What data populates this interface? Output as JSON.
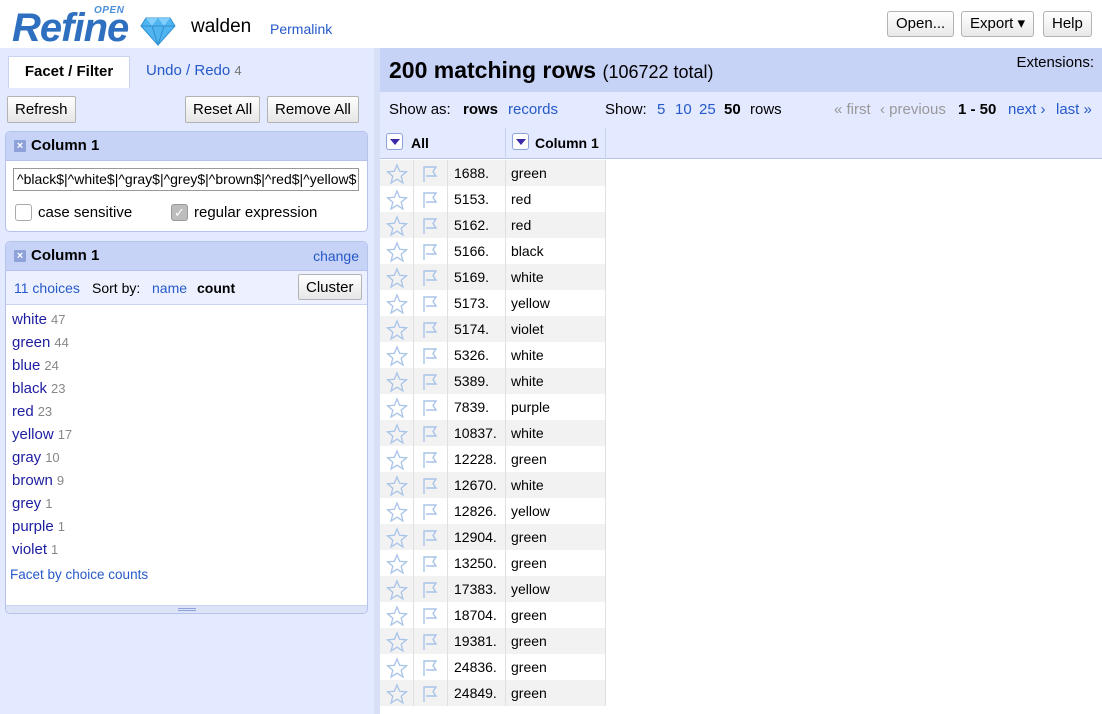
{
  "header": {
    "logo_open": "OPEN",
    "logo_refine": "Refine",
    "project_name": "walden",
    "permalink": "Permalink",
    "open_button": "Open...",
    "export_button": "Export ▾",
    "help_button": "Help"
  },
  "left": {
    "tab_facet": "Facet / Filter",
    "tab_undo": "Undo / Redo",
    "tab_undo_count": "4",
    "refresh": "Refresh",
    "reset_all": "Reset All",
    "remove_all": "Remove All",
    "text_facet": {
      "title": "Column 1",
      "value": "^black$|^white$|^gray$|^grey$|^brown$|^red$|^yellow$",
      "case_sensitive_label": "case sensitive",
      "case_sensitive": false,
      "regex_label": "regular expression",
      "regex": true
    },
    "list_facet": {
      "title": "Column 1",
      "change": "change",
      "choices_count": "11 choices",
      "sort_by": "Sort by:",
      "sort_name": "name",
      "sort_count": "count",
      "cluster": "Cluster",
      "choices": [
        {
          "label": "white",
          "count": "47"
        },
        {
          "label": "green",
          "count": "44"
        },
        {
          "label": "blue",
          "count": "24"
        },
        {
          "label": "black",
          "count": "23"
        },
        {
          "label": "red",
          "count": "23"
        },
        {
          "label": "yellow",
          "count": "17"
        },
        {
          "label": "gray",
          "count": "10"
        },
        {
          "label": "brown",
          "count": "9"
        },
        {
          "label": "grey",
          "count": "1"
        },
        {
          "label": "purple",
          "count": "1"
        },
        {
          "label": "violet",
          "count": "1"
        }
      ],
      "facet_by_counts": "Facet by choice counts"
    }
  },
  "right": {
    "matching": "200 matching rows",
    "total": "(106722 total)",
    "extensions": "Extensions:",
    "show_as": "Show as:",
    "rows": "rows",
    "records": "records",
    "show": "Show:",
    "page_sizes": [
      "5",
      "10",
      "25",
      "50"
    ],
    "rows_suffix": "rows",
    "first": "« first",
    "previous": "‹ previous",
    "range": "1 - 50",
    "next": "next ›",
    "last": "last »",
    "col_all": "All",
    "col_1": "Column 1",
    "rows_data": [
      {
        "n": "1688.",
        "v": "green"
      },
      {
        "n": "5153.",
        "v": "red"
      },
      {
        "n": "5162.",
        "v": "red"
      },
      {
        "n": "5166.",
        "v": "black"
      },
      {
        "n": "5169.",
        "v": "white"
      },
      {
        "n": "5173.",
        "v": "yellow"
      },
      {
        "n": "5174.",
        "v": "violet"
      },
      {
        "n": "5326.",
        "v": "white"
      },
      {
        "n": "5389.",
        "v": "white"
      },
      {
        "n": "7839.",
        "v": "purple"
      },
      {
        "n": "10837.",
        "v": "white"
      },
      {
        "n": "12228.",
        "v": "green"
      },
      {
        "n": "12670.",
        "v": "white"
      },
      {
        "n": "12826.",
        "v": "yellow"
      },
      {
        "n": "12904.",
        "v": "green"
      },
      {
        "n": "13250.",
        "v": "green"
      },
      {
        "n": "17383.",
        "v": "yellow"
      },
      {
        "n": "18704.",
        "v": "green"
      },
      {
        "n": "19381.",
        "v": "green"
      },
      {
        "n": "24836.",
        "v": "green"
      },
      {
        "n": "24849.",
        "v": "green"
      }
    ]
  },
  "colors": {
    "link": "#2659c9",
    "panel_bg": "#e3e9ff",
    "facet_header": "#c7d2f7",
    "choice_text": "#1d1da0"
  }
}
